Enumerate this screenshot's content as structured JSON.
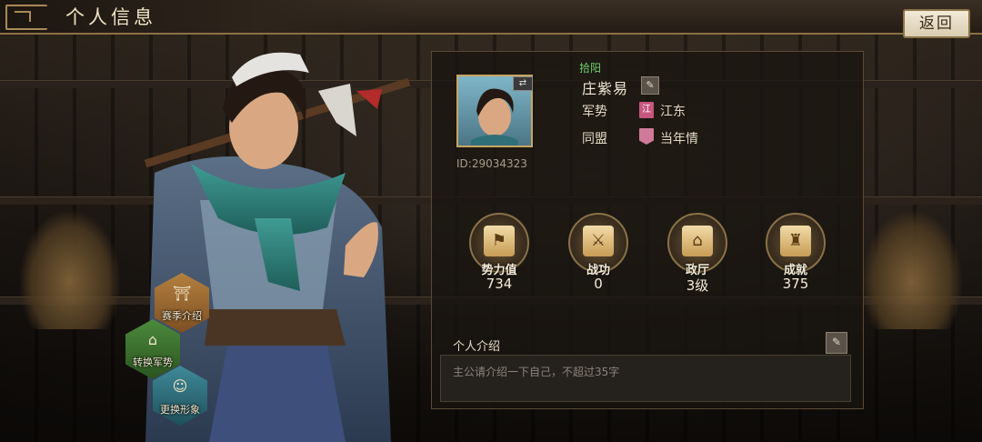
{
  "header": {
    "title": "个人信息",
    "back_label": "返回"
  },
  "side_buttons": [
    {
      "label": "赛季介绍",
      "icon": "pavilion-icon"
    },
    {
      "label": "转换军势",
      "icon": "fortress-icon"
    },
    {
      "label": "更换形象",
      "icon": "portrait-icon"
    }
  ],
  "profile": {
    "server": "拾阳",
    "name": "庄紫易",
    "id_text": "ID:29034323",
    "faction_label": "军势",
    "faction_flag": "江",
    "faction_value": "江东",
    "alliance_label": "同盟",
    "alliance_value": "当年情"
  },
  "stats": [
    {
      "label": "势力值",
      "value": "734",
      "icon": "banner-icon"
    },
    {
      "label": "战功",
      "value": "0",
      "icon": "sword-icon"
    },
    {
      "label": "政厅",
      "value": "3级",
      "icon": "palace-icon"
    },
    {
      "label": "成就",
      "value": "375",
      "icon": "cauldron-icon"
    }
  ],
  "intro": {
    "heading": "个人介绍",
    "placeholder": "主公请介绍一下自己，不超过35字"
  },
  "colors": {
    "accent_gold": "#c7a565",
    "server_green": "#6fd06a",
    "faction_pink": "#c7567f"
  }
}
